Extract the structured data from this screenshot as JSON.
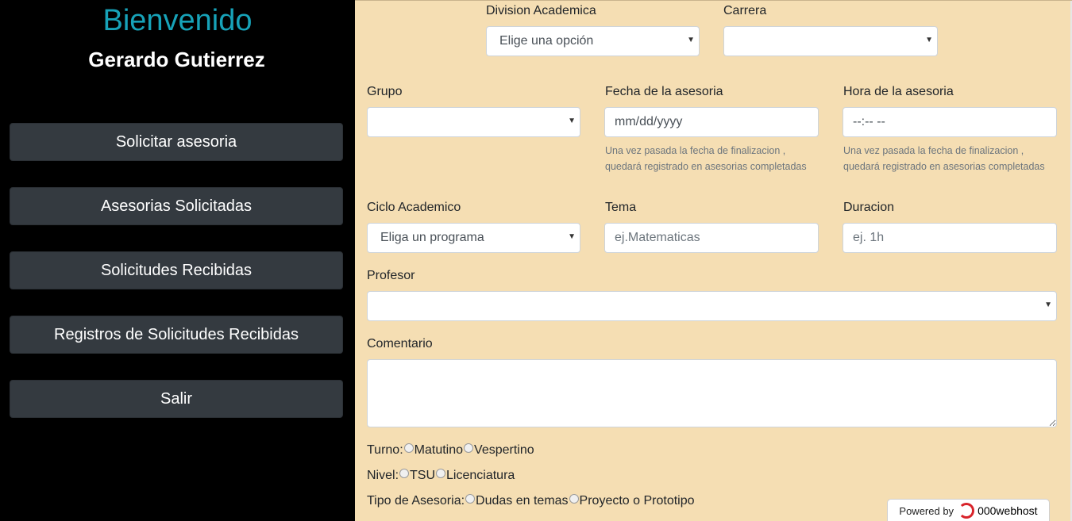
{
  "sidebar": {
    "welcome": "Bienvenido",
    "username": "Gerardo Gutierrez",
    "items": [
      {
        "label": "Solicitar asesoria"
      },
      {
        "label": "Asesorias Solicitadas"
      },
      {
        "label": "Solicitudes Recibidas"
      },
      {
        "label": "Registros de Solicitudes Recibidas"
      },
      {
        "label": "Salir"
      }
    ]
  },
  "form": {
    "division": {
      "label": "Division Academica",
      "value": "Elige una opción"
    },
    "carrera": {
      "label": "Carrera",
      "value": ""
    },
    "grupo": {
      "label": "Grupo",
      "value": ""
    },
    "fecha": {
      "label": "Fecha de la asesoria",
      "value": "mm/dd/yyyy",
      "help": "Una vez pasada la fecha de finalizacion , quedará registrado en asesorias completadas"
    },
    "hora": {
      "label": "Hora de la asesoria",
      "value": "--:-- --",
      "help": "Una vez pasada la fecha de finalizacion , quedará registrado en asesorias completadas"
    },
    "ciclo": {
      "label": "Ciclo Academico",
      "value": "Eliga un programa"
    },
    "tema": {
      "label": "Tema",
      "placeholder": "ej.Matematicas"
    },
    "duracion": {
      "label": "Duracion",
      "placeholder": "ej. 1h"
    },
    "profesor": {
      "label": "Profesor",
      "value": ""
    },
    "comentario": {
      "label": "Comentario",
      "value": ""
    },
    "turno": {
      "label": "Turno:",
      "options": [
        "Matutino",
        "Vespertino"
      ]
    },
    "nivel": {
      "label": "Nivel:",
      "options": [
        "TSU",
        "Licenciatura"
      ]
    },
    "tipo": {
      "label": "Tipo de Asesoria:",
      "options": [
        "Dudas en temas",
        "Proyecto o Prototipo"
      ]
    }
  },
  "footer": {
    "powered_by": "Powered by",
    "brand": "000webhost"
  },
  "icons": {
    "dropdown": "chevron-down-icon",
    "radio": "radio-icon",
    "host_logo": "000webhost-logo-icon"
  },
  "colors": {
    "welcome": "#17a2b8",
    "sidebar_bg": "#000000",
    "nav_button": "#343a40",
    "main_bg": "#f5deb3"
  }
}
